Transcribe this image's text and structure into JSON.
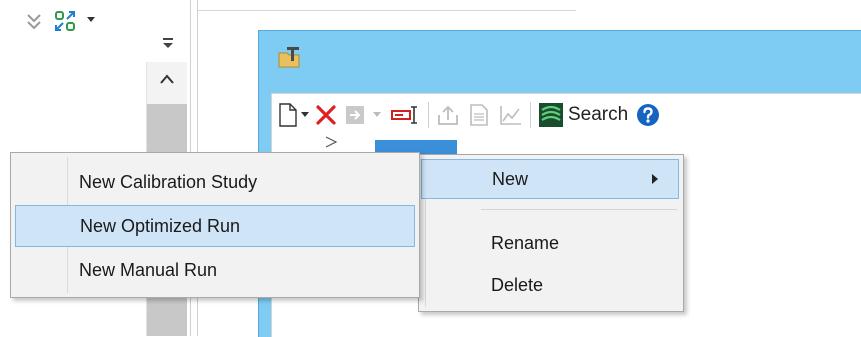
{
  "toolbar": {
    "search_label": "Search"
  },
  "context_menu": {
    "items": [
      {
        "label": "New",
        "highlighted": true,
        "has_submenu": true
      },
      {
        "label": "Rename",
        "highlighted": false
      },
      {
        "label": "Delete",
        "highlighted": false
      }
    ]
  },
  "sub_menu": {
    "items": [
      {
        "label": "New Calibration Study",
        "highlighted": false
      },
      {
        "label": "New Optimized Run",
        "highlighted": true
      },
      {
        "label": "New Manual Run",
        "highlighted": false
      }
    ]
  },
  "colors": {
    "window_bg": "#7ecbf3",
    "menu_bg": "#f2f2f2",
    "highlight": "#cfe4f7",
    "delete_red": "#e02020",
    "help_blue": "#1565c0"
  }
}
